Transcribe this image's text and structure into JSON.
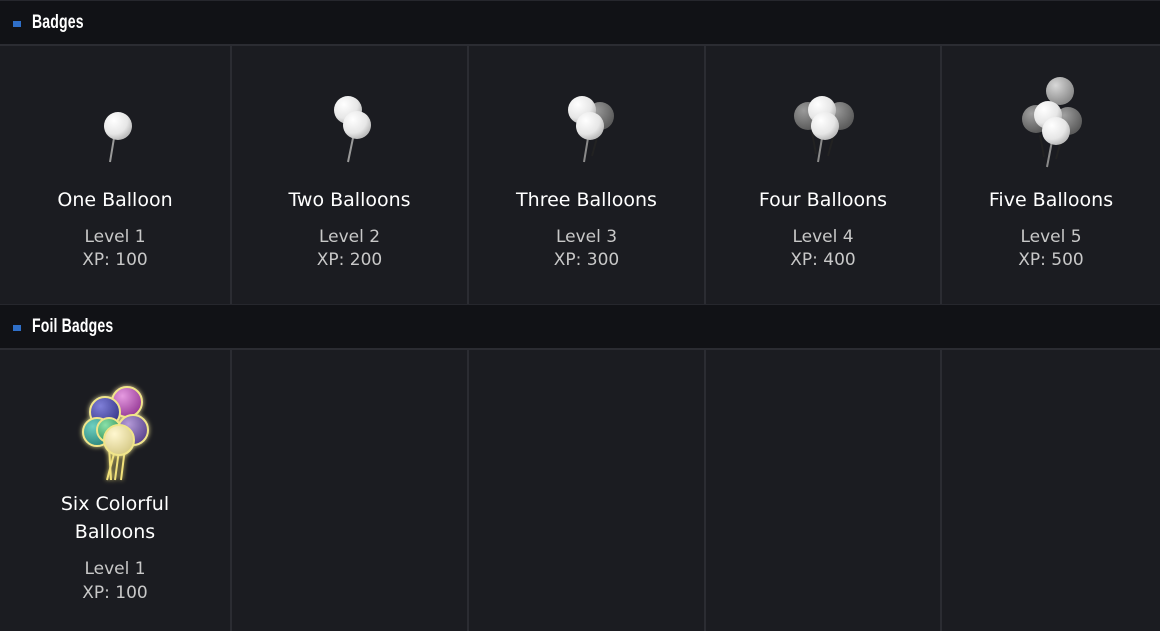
{
  "sections": [
    {
      "title": "Badges",
      "items": [
        {
          "name": "One Balloon",
          "level": "Level 1",
          "xp": "XP: 100",
          "icon": "one-balloon-icon"
        },
        {
          "name": "Two Balloons",
          "level": "Level 2",
          "xp": "XP: 200",
          "icon": "two-balloons-icon"
        },
        {
          "name": "Three Balloons",
          "level": "Level 3",
          "xp": "XP: 300",
          "icon": "three-balloons-icon"
        },
        {
          "name": "Four Balloons",
          "level": "Level 4",
          "xp": "XP: 400",
          "icon": "four-balloons-icon"
        },
        {
          "name": "Five Balloons",
          "level": "Level 5",
          "xp": "XP: 500",
          "icon": "five-balloons-icon"
        }
      ]
    },
    {
      "title": "Foil Badges",
      "items": [
        {
          "name": "Six Colorful Balloons",
          "level": "Level 1",
          "xp": "XP: 100",
          "icon": "six-colorful-balloons-icon"
        }
      ]
    }
  ],
  "colors": {
    "background": "#1b1c21",
    "header_background": "#111216",
    "accent": "#2f6fc8",
    "secondary_text": "#c8c8c8"
  }
}
